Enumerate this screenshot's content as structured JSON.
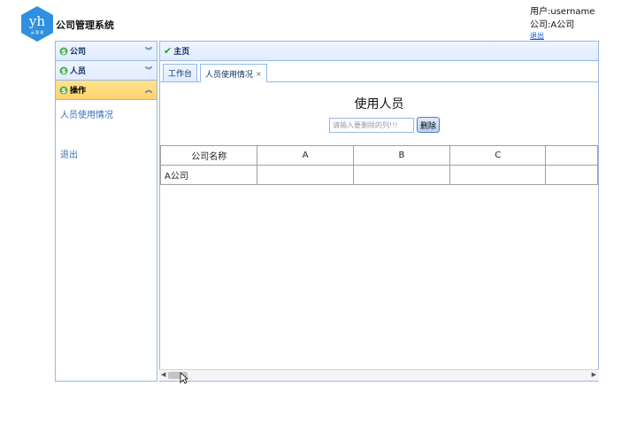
{
  "header": {
    "logo_text": "yh",
    "logo_subtext": "云 管 理",
    "title": "公司管理系统",
    "user_line": "用户:username",
    "company_line": "公司:A公司",
    "logout_link": "退出"
  },
  "sidebar": {
    "sections": [
      {
        "label": "公司",
        "state": "collapsed"
      },
      {
        "label": "人员",
        "state": "collapsed"
      },
      {
        "label": "操作",
        "state": "expanded"
      }
    ],
    "links": [
      "人员使用情况",
      "退出"
    ]
  },
  "main": {
    "panel_title": "主页",
    "tabs": [
      {
        "label": "工作台",
        "active": false
      },
      {
        "label": "人员使用情况",
        "active": true,
        "close": "×"
      }
    ],
    "heading": "使用人员",
    "delete_placeholder": "请输入要删除的列!!!",
    "delete_button": "删除",
    "table": {
      "columns": [
        "公司名称",
        "A",
        "B",
        "C",
        ""
      ],
      "rows": [
        [
          "A公司",
          "",
          "",
          "",
          ""
        ]
      ]
    }
  },
  "colors": {
    "border": "#95b8e7",
    "selected_header": "#ffd26e",
    "link": "#3b6fb6",
    "logo": "#2f8fe0"
  }
}
